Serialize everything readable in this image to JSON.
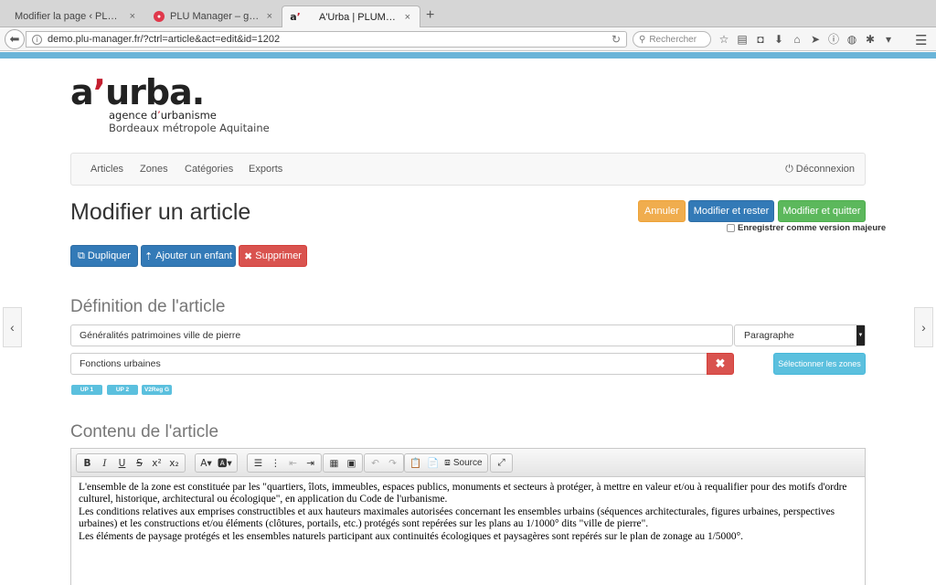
{
  "browser": {
    "tabs": [
      {
        "title": "Modifier la page ‹ PLU Manager…"
      },
      {
        "title": "PLU Manager – gestion du…"
      },
      {
        "title": "A'Urba | PLUManager"
      }
    ],
    "close_glyph": "×",
    "new_tab_glyph": "+",
    "url": "demo.plu-manager.fr/?ctrl=article&act=edit&id=1202",
    "search_placeholder": "Rechercher",
    "toolbar_icons": [
      "star-icon",
      "reading-list-icon",
      "pocket-icon",
      "download-icon",
      "home-icon",
      "send-icon",
      "info-icon",
      "chat-icon",
      "extension-icon",
      "dropdown-icon"
    ]
  },
  "logo": {
    "main_a": "a",
    "main_apos": "’",
    "main_rest": "urba",
    "main_dot": ".",
    "sub1_a": "agence d",
    "sub1_apos": "’",
    "sub1_b": "urbanisme",
    "sub2": "Bordeaux métropole Aquitaine"
  },
  "nav": {
    "items": [
      "Articles",
      "Zones",
      "Catégories",
      "Exports"
    ],
    "logout": "Déconnexion"
  },
  "page": {
    "title": "Modifier un article"
  },
  "actions": {
    "cancel": "Annuler",
    "save_stay": "Modifier et rester",
    "save_quit": "Modifier et quitter",
    "major_version": "Enregistrer comme version majeure",
    "duplicate": "Dupliquer",
    "add_child": "Ajouter un enfant",
    "delete": "Supprimer"
  },
  "definition": {
    "heading": "Définition de l'article",
    "title_value": "Généralités patrimoines ville de pierre",
    "type_value": "Paragraphe",
    "category_value": "Fonctions urbaines",
    "select_zones": "Sélectionner les zones",
    "zones": [
      "UP 1",
      "UP 2",
      "V2Reg G"
    ]
  },
  "content": {
    "heading": "Contenu de l'article",
    "source_label": "Source",
    "paragraphs": [
      "L'ensemble de la zone est constituée par les \"quartiers, îlots, immeubles, espaces publics, monuments et secteurs à protéger, à mettre en valeur et/ou à requalifier pour des motifs d'ordre culturel, historique, architectural ou écologique\", en application du Code de l'urbanisme.",
      "Les conditions relatives aux emprises constructibles et aux hauteurs maximales autorisées concernant les ensembles urbains (séquences architecturales, figures urbaines, perspectives urbaines) et les constructions et/ou éléments (clôtures, portails, etc.) protégés sont repérées sur les plans au 1/1000° dits \"ville de pierre\".",
      "Les éléments de paysage protégés et les ensembles naturels participant aux continuités écologiques et paysagères sont repérés sur le plan de zonage au 1/5000°."
    ]
  }
}
